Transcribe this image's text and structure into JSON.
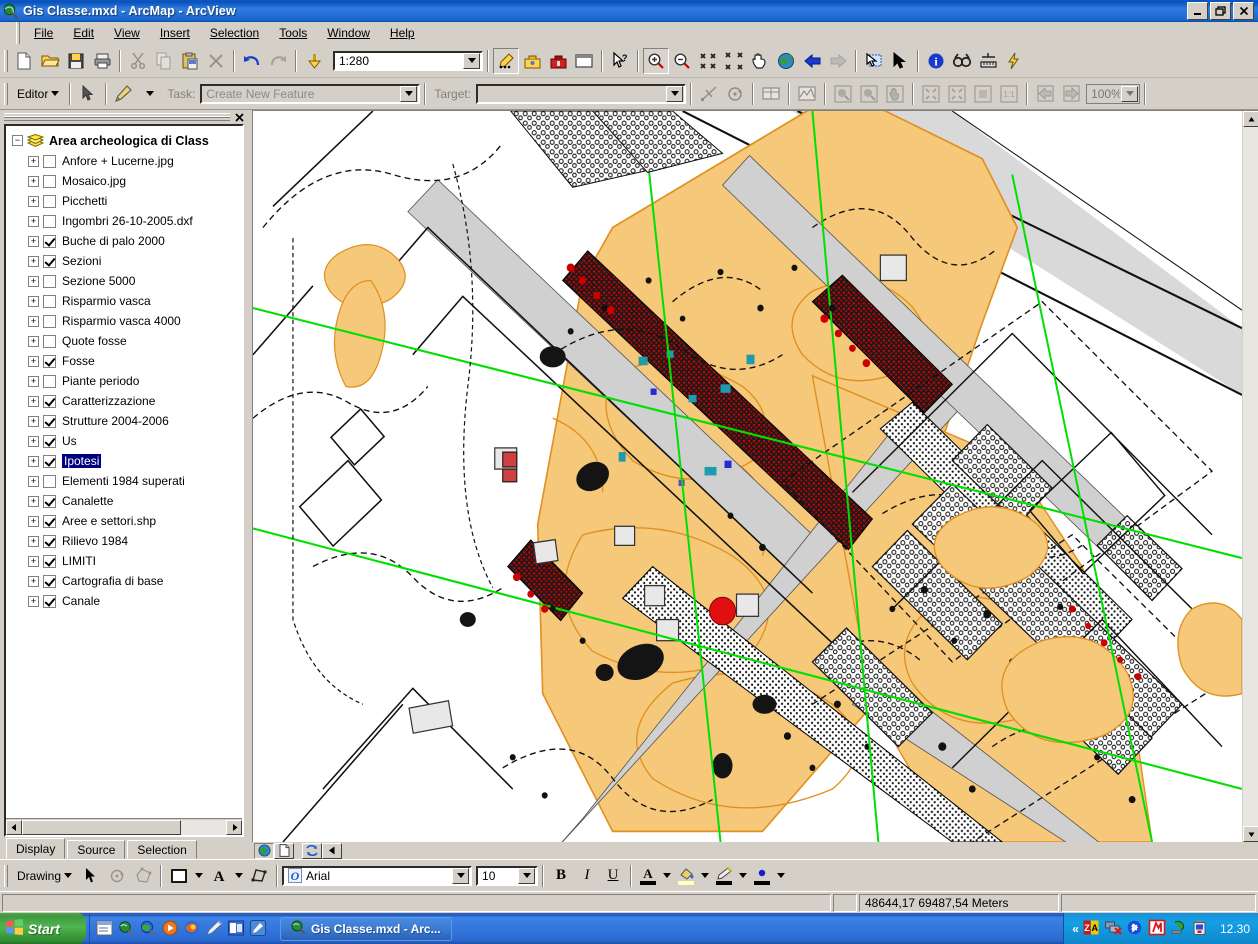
{
  "window": {
    "title": "Gis Classe.mxd - ArcMap - ArcView",
    "minimize": "_",
    "restore": "❐",
    "close": "✕"
  },
  "menu": [
    {
      "label": "File"
    },
    {
      "label": "Edit"
    },
    {
      "label": "View"
    },
    {
      "label": "Insert"
    },
    {
      "label": "Selection"
    },
    {
      "label": "Tools"
    },
    {
      "label": "Window"
    },
    {
      "label": "Help"
    }
  ],
  "standard_toolbar": {
    "scale_value": "1:280",
    "buttons": [
      "new-map-icon",
      "open-icon",
      "save-icon",
      "print-icon",
      "cut-icon",
      "copy-icon",
      "paste-icon",
      "delete-icon",
      "undo-icon",
      "redo-icon",
      "add-data-icon"
    ],
    "right_buttons": [
      "editor-toolbar-icon",
      "arctoolbox-icon",
      "toolbox-icon",
      "command-line-icon",
      "whats-this-icon",
      "zoom-in-icon",
      "zoom-out-icon",
      "fixed-zoom-in-icon",
      "fixed-zoom-out-icon",
      "pan-icon",
      "full-extent-icon",
      "go-back-extent-icon",
      "go-forward-extent-icon",
      "select-features-icon",
      "select-elements-icon",
      "identify-icon",
      "find-icon",
      "measure-icon",
      "hyperlink-icon"
    ]
  },
  "editor_toolbar": {
    "editor_label": "Editor",
    "task_label": "Task:",
    "task_value": "Create New Feature",
    "target_label": "Target:",
    "target_value": "",
    "zoom_percent": "100%"
  },
  "toc": {
    "close_label": "✕",
    "root": "Area archeologica di Class",
    "layers": [
      {
        "label": "Anfore + Lucerne.jpg",
        "checked": false
      },
      {
        "label": "Mosaico.jpg",
        "checked": false
      },
      {
        "label": "Picchetti",
        "checked": false
      },
      {
        "label": "Ingombri 26-10-2005.dxf",
        "checked": false
      },
      {
        "label": "Buche di palo 2000",
        "checked": true
      },
      {
        "label": "Sezioni",
        "checked": true
      },
      {
        "label": "Sezione 5000",
        "checked": false
      },
      {
        "label": "Risparmio vasca",
        "checked": false
      },
      {
        "label": "Risparmio vasca 4000",
        "checked": false
      },
      {
        "label": "Quote fosse",
        "checked": false
      },
      {
        "label": "Fosse",
        "checked": true
      },
      {
        "label": "Piante periodo",
        "checked": false
      },
      {
        "label": "Caratterizzazione",
        "checked": true
      },
      {
        "label": "Strutture 2004-2006",
        "checked": true
      },
      {
        "label": "Us",
        "checked": true
      },
      {
        "label": "Ipotesi",
        "checked": true,
        "selected": true
      },
      {
        "label": "Elementi 1984 superati",
        "checked": false
      },
      {
        "label": "Canalette",
        "checked": true
      },
      {
        "label": "Aree e settori.shp",
        "checked": true
      },
      {
        "label": "Rilievo 1984",
        "checked": true
      },
      {
        "label": "LIMITI",
        "checked": true
      },
      {
        "label": "Cartografia di base",
        "checked": true
      },
      {
        "label": "Canale",
        "checked": true
      }
    ],
    "expander_symbol": "+",
    "root_expander_symbol": "−",
    "tabs": [
      {
        "label": "Display",
        "active": true
      },
      {
        "label": "Source",
        "active": false
      },
      {
        "label": "Selection",
        "active": false
      }
    ]
  },
  "map": {
    "view_buttons": [
      "data-view-icon",
      "layout-view-icon",
      "refresh-icon",
      "pause-drawing-icon"
    ],
    "colors": {
      "fill_orange": "#f5c87a",
      "fill_orange_dark": "#e8a84a",
      "grey_band": "#d9d9d9",
      "green_line": "#00e000",
      "wall_red": "#cc0000",
      "background": "#ffffff"
    }
  },
  "drawing_toolbar": {
    "drawing_label": "Drawing",
    "font_name": "Arial",
    "font_size": "10",
    "bold": "B",
    "italic": "I",
    "underline": "U",
    "buttons": [
      "select-elements-icon",
      "rotate-icon",
      "shape-icon",
      "new-rectangle-icon",
      "new-text-icon",
      "edit-vertices-icon"
    ],
    "colors": {
      "font_color": "#000000",
      "fill_color": "#ffffc0",
      "line_color": "#000000",
      "marker_color": "#0000cc"
    }
  },
  "statusbar": {
    "coordinates": "48644,17  69487,54 Meters",
    "message": ""
  },
  "taskbar": {
    "start_label": "Start",
    "quick_launch": [
      "show-desktop-icon",
      "arccatalog-icon",
      "arcmap-icon",
      "media-player-icon",
      "firefox-icon",
      "pen-icon",
      "outlook-icon",
      "edit-icon"
    ],
    "task_title": "Gis Classe.mxd - Arc...",
    "tray_icons": [
      "zonealarm-icon",
      "network-disconnected-icon",
      "bluetooth-icon",
      "avira-icon",
      "safely-remove-icon",
      "battery-icon"
    ],
    "clock": "12.30",
    "chevron": "«"
  }
}
